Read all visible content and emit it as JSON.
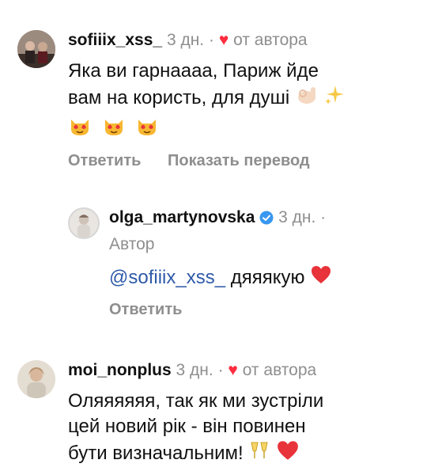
{
  "comments": [
    {
      "username": "sofiiix_xss_",
      "time": "3 дн.",
      "dot": "·",
      "heart": "♥",
      "author_like": "от автора",
      "lines": [
        "Яка ви гарнаааа, Париж йде",
        "вам на користь, для душі"
      ],
      "reply_label": "Ответить",
      "translate_label": "Показать перевод"
    },
    {
      "username": "olga_martynovska",
      "time": "3 дн.",
      "dot": "·",
      "role": "Автор",
      "mention": "@sofiiix_xss_",
      "text": "дяяякую",
      "reply_label": "Ответить"
    },
    {
      "username": "moi_nonplus",
      "time": "3 дн.",
      "dot": "·",
      "heart": "♥",
      "author_like": "от автора",
      "lines": [
        "Оляяяяяя, так як ми зустріли",
        "цей новий рік - він повинен",
        "бути визначальним!"
      ]
    }
  ],
  "colors": {
    "meta": "#8e8e8e",
    "heart": "#ff2d3f",
    "mention": "#2f5aa8",
    "verified": "#3897f0"
  },
  "icons": [
    "ok-hand-emoji",
    "sparkles-emoji",
    "heart-eyes-cat-emoji",
    "red-heart-emoji",
    "champagne-glasses-emoji",
    "verified-badge-icon"
  ]
}
